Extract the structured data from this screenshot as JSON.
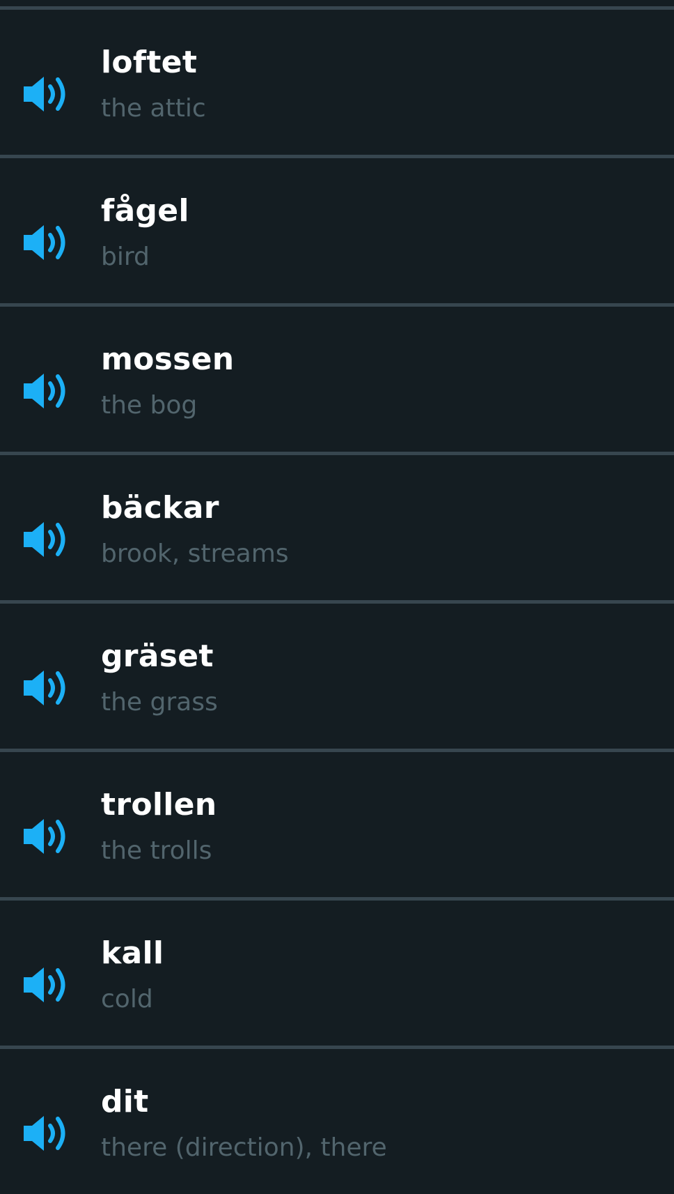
{
  "colors": {
    "background": "#141d22",
    "divider": "#37464f",
    "speaker_icon": "#1cb0f6",
    "word_text": "#ffffff",
    "translation_text": "#52656d"
  },
  "vocab_list": {
    "items": [
      {
        "word": "loftet",
        "translation": "the attic",
        "icon": "speaker-icon"
      },
      {
        "word": "fågel",
        "translation": "bird",
        "icon": "speaker-icon"
      },
      {
        "word": "mossen",
        "translation": "the bog",
        "icon": "speaker-icon"
      },
      {
        "word": "bäckar",
        "translation": "brook, streams",
        "icon": "speaker-icon"
      },
      {
        "word": "gräset",
        "translation": "the grass",
        "icon": "speaker-icon"
      },
      {
        "word": "trollen",
        "translation": "the trolls",
        "icon": "speaker-icon"
      },
      {
        "word": "kall",
        "translation": "cold",
        "icon": "speaker-icon"
      },
      {
        "word": "dit",
        "translation": "there (direction), there",
        "icon": "speaker-icon"
      }
    ]
  }
}
